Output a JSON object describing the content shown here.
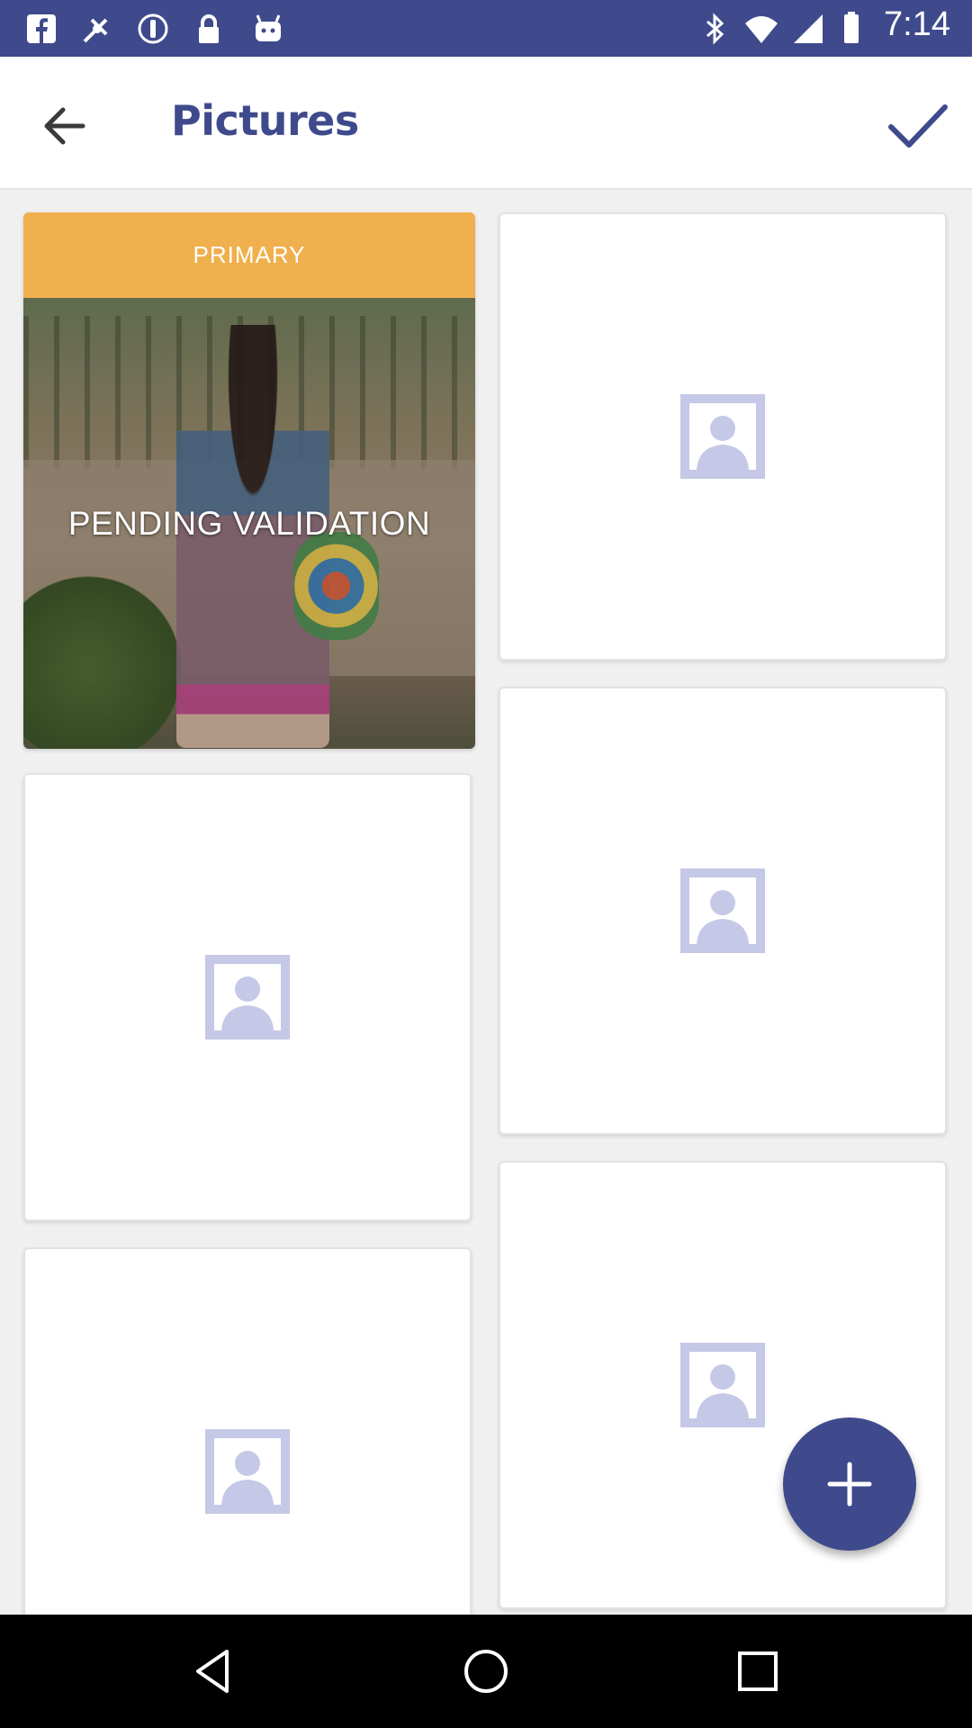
{
  "status_bar": {
    "time": "7:14",
    "left_icons": [
      "facebook-icon",
      "fake-gps-icon",
      "info-icon",
      "lock-icon",
      "android-icon"
    ],
    "right_icons": [
      "bluetooth-icon",
      "wifi-icon",
      "signal-icon",
      "battery-icon"
    ]
  },
  "app_bar": {
    "title": "Pictures",
    "back_icon": "arrow-back-icon",
    "confirm_icon": "check-icon"
  },
  "pictures": {
    "primary_label": "PRIMARY",
    "primary_status": "PENDING VALIDATION",
    "empty_slot_icon": "person-placeholder-icon",
    "empty_slots": 5
  },
  "fab": {
    "icon": "plus-icon"
  },
  "nav_bar": {
    "icons": [
      "back-triangle-icon",
      "home-circle-icon",
      "recents-square-icon"
    ]
  },
  "colors": {
    "primary": "#3f4a8c",
    "accent": "#f0b04d",
    "placeholder": "#c5c8e6"
  }
}
